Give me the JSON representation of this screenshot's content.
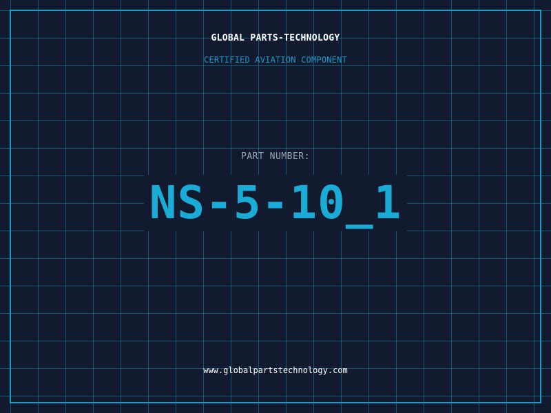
{
  "header": {
    "company": "GLOBAL PARTS-TECHNOLOGY",
    "subtitle": "CERTIFIED AVIATION COMPONENT"
  },
  "part": {
    "label": "PART NUMBER:",
    "number": "NS-5-10_1"
  },
  "footer": {
    "website": "www.globalpartstechnology.com"
  },
  "colors": {
    "background": "#111a2e",
    "grid": "#1887aa",
    "accent": "#1aabd6",
    "label": "#9aa7b8",
    "text": "#ffffff"
  }
}
